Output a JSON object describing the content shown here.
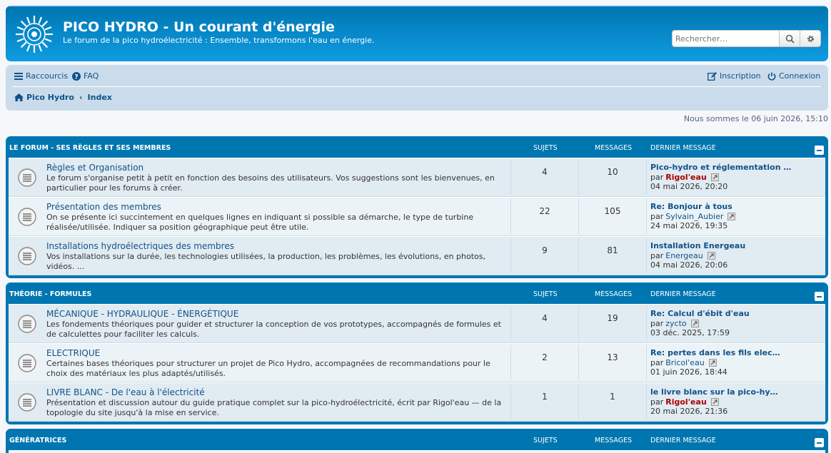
{
  "header": {
    "title": "PICO HYDRO - Un courant d'énergie",
    "description": "Le forum de la pico hydroélectricité : Ensemble, transformons l'eau en énergie.",
    "search_placeholder": "Rechercher…"
  },
  "nav": {
    "shortcuts": "Raccourcis",
    "faq": "FAQ",
    "register": "Inscription",
    "login": "Connexion",
    "breadcrumb": [
      "Pico Hydro",
      "Index"
    ]
  },
  "datetime": "Nous sommes le 06 juin 2026, 15:10",
  "columns": {
    "topics": "SUJETS",
    "posts": "MESSAGES",
    "last": "DERNIER MESSAGE"
  },
  "categories": [
    {
      "title": "LE FORUM - SES RÈGLES ET SES MEMBRES",
      "forums": [
        {
          "name": "Règles et Organisation",
          "desc": "Le forum s'organise petit à petit en fonction des besoins des utilisateurs. Vos suggestions sont les bienvenues, en particulier pour les forums à créer.",
          "topics": "4",
          "posts": "10",
          "last_title": "Pico-hydro et réglementation …",
          "by": "par",
          "last_user": "Rigol'eau",
          "admin": true,
          "last_date": "04 mai 2026, 20:20"
        },
        {
          "name": "Présentation des membres",
          "desc": "On se présente ici succintement en quelques lignes en indiquant si possible sa démarche, le type de turbine réalisée/utilisée. Indiquer sa position géographique peut être utile.",
          "topics": "22",
          "posts": "105",
          "last_title": "Re: Bonjour à tous",
          "by": "par",
          "last_user": "Sylvain_Aubier",
          "admin": false,
          "last_date": "24 mai 2026, 19:35"
        },
        {
          "name": "Installations hydroélectriques des membres",
          "desc": "Vos installations sur la durée, les technologies utilisées, la production, les problèmes, les évolutions, en photos, vidéos. ...",
          "topics": "9",
          "posts": "81",
          "last_title": "Installation Energeau",
          "by": "par",
          "last_user": "Energeau",
          "admin": false,
          "last_date": "04 mai 2026, 20:06"
        }
      ]
    },
    {
      "title": "THÉORIE - FORMULES",
      "forums": [
        {
          "name": "MÉCANIQUE - HYDRAULIQUE - ÉNERGÉTIQUE",
          "desc": "Les fondements théoriques pour guider et structurer la conception de vos prototypes, accompagnés de formules et de calculettes pour faciliter les calculs.",
          "topics": "4",
          "posts": "19",
          "last_title": "Re: Calcul d'ébit d'eau",
          "by": "par",
          "last_user": "zycto",
          "admin": false,
          "last_date": "03 déc. 2025, 17:59"
        },
        {
          "name": "ELECTRIQUE",
          "desc": "Certaines bases théoriques pour structurer un projet de Pico Hydro, accompagnées de recommandations pour le choix des matériaux les plus adaptés/utilisés.",
          "topics": "2",
          "posts": "13",
          "last_title": "Re: pertes dans les fils elec…",
          "by": "par",
          "last_user": "Bricol'eau",
          "admin": false,
          "last_date": "01 juin 2026, 18:44"
        },
        {
          "name": "LIVRE BLANC - De l'eau à l'électricité",
          "desc": "Présentation et discussion autour du guide pratique complet sur la pico-hydroélectricité, écrit par Rigol'eau — de la topologie du site jusqu'à la mise en service.",
          "topics": "1",
          "posts": "1",
          "last_title": "le livre blanc sur la pico-hy…",
          "by": "par",
          "last_user": "Rigol'eau",
          "admin": true,
          "last_date": "20 mai 2026, 21:36"
        }
      ]
    },
    {
      "title": "GÉNÉRATRICES",
      "forums": []
    }
  ],
  "colors": {
    "header_blue": "#12a3eb",
    "link": "#105289",
    "admin": "#AA0000"
  }
}
